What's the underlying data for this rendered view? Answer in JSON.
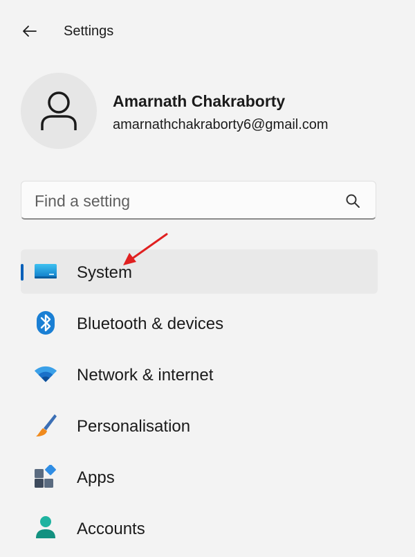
{
  "window": {
    "title": "Settings"
  },
  "profile": {
    "name": "Amarnath Chakraborty",
    "email": "amarnathchakraborty6@gmail.com"
  },
  "search": {
    "placeholder": "Find a setting"
  },
  "nav": {
    "items": [
      {
        "label": "System",
        "icon": "system-display-icon",
        "selected": true
      },
      {
        "label": "Bluetooth & devices",
        "icon": "bluetooth-icon",
        "selected": false
      },
      {
        "label": "Network & internet",
        "icon": "wifi-icon",
        "selected": false
      },
      {
        "label": "Personalisation",
        "icon": "paintbrush-icon",
        "selected": false
      },
      {
        "label": "Apps",
        "icon": "apps-icon",
        "selected": false
      },
      {
        "label": "Accounts",
        "icon": "accounts-icon",
        "selected": false
      }
    ]
  },
  "colors": {
    "accent": "#005fb8",
    "annotation_arrow": "#e02020"
  }
}
